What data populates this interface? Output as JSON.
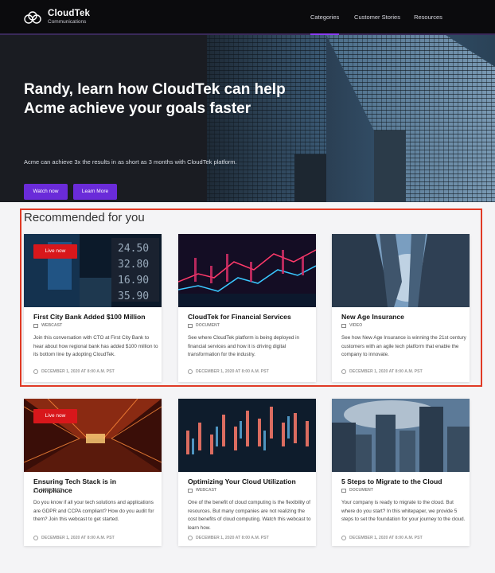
{
  "header": {
    "brand_name": "CloudTek",
    "brand_sub": "Communications",
    "nav": [
      {
        "label": "Categories",
        "active": true
      },
      {
        "label": "Customer Stories",
        "active": false
      },
      {
        "label": "Resources",
        "active": false
      }
    ]
  },
  "hero": {
    "title": "Randy, learn how CloudTek can help Acme achieve your goals faster",
    "subtitle": "Acme can achieve 3x the results in as short as 3 months with CloudTek platform.",
    "watch_label": "Watch now",
    "learn_label": "Learn More"
  },
  "section": {
    "title": "Recommended for you"
  },
  "colors": {
    "accent": "#6a2bd9",
    "live_badge": "#d8171b",
    "highlight": "#e03a25"
  },
  "cards": [
    {
      "live": "Live now",
      "title": "First City Bank Added $100 Million",
      "type": "WEBCAST",
      "desc": "Join this conversation with CTO at First City Bank to hear about how regional bank has added $100 million to its bottom line by adopting CloudTek.",
      "date": "DECEMBER 1, 2020 AT 8:00 A.M. PST"
    },
    {
      "title": "CloudTek for Financial Services",
      "type": "DOCUMENT",
      "desc": "See where CloudTek platform is being deployed in financial services and how it is driving digital transformation for the industry.",
      "date": "DECEMBER 1, 2020 AT 8:00 A.M. PST"
    },
    {
      "title": "New Age Insurance",
      "type": "VIDEO",
      "desc": "See how New Age Insurance is winning the 21st century customers with an agile tech platform that enable the company to innovate.",
      "date": "DECEMBER 1, 2020 AT 8:00 A.M. PST"
    },
    {
      "live": "Live now",
      "title": "Ensuring Tech Stack is in Compliance",
      "type": "WEBCAST",
      "desc": "Do you know if all your tech solutions and applications are GDPR and CCPA compliant? How do you audit for them? Join this webcast to get started.",
      "date": "DECEMBER 1, 2020 AT 8:00 A.M. PST"
    },
    {
      "title": "Optimizing Your Cloud Utilization",
      "type": "WEBCAST",
      "desc": "One of the benefit of cloud computing is the flexibility of resources. But many companies are not realizing the cost benefits of cloud computing. Watch this webcast to learn how.",
      "date": "DECEMBER 1, 2020 AT 8:00 A.M. PST"
    },
    {
      "title": "5 Steps to Migrate to the Cloud",
      "type": "DOCUMENT",
      "desc": "Your company is ready to migrate to the cloud. But where do you start? In this whitepaper, we provide 5 steps to set the foundation for your journey to the cloud.",
      "date": "DECEMBER 1, 2020 AT 8:00 A.M. PST"
    }
  ]
}
